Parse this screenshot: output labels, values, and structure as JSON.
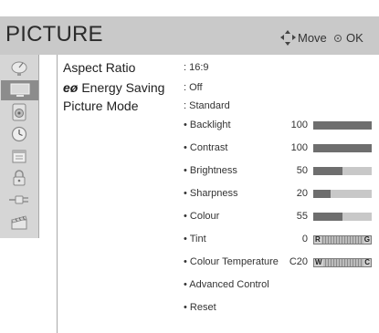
{
  "screen": {
    "title": "PICTURE",
    "hints": {
      "move": "Move",
      "ok": "OK"
    }
  },
  "sidebar": {
    "items": [
      {
        "icon": "satellite-dish-icon",
        "active": false
      },
      {
        "icon": "tv-screen-icon",
        "active": true
      },
      {
        "icon": "speaker-icon",
        "active": false
      },
      {
        "icon": "clock-icon",
        "active": false
      },
      {
        "icon": "calendar-icon",
        "active": false
      },
      {
        "icon": "padlock-icon",
        "active": false
      },
      {
        "icon": "input-plug-icon",
        "active": false
      },
      {
        "icon": "clapperboard-icon",
        "active": false
      }
    ]
  },
  "menu": {
    "aspect_ratio": {
      "label": "Aspect Ratio",
      "value": ": 16:9"
    },
    "energy_saving": {
      "label": "Energy Saving",
      "eco_glyph": "eø",
      "value": ": Off"
    },
    "picture_mode": {
      "label": "Picture Mode",
      "value": ": Standard"
    },
    "settings": [
      {
        "label": "• Backlight",
        "value": "100",
        "level": 1.0,
        "type": "bar"
      },
      {
        "label": "• Contrast",
        "value": "100",
        "level": 1.0,
        "type": "bar"
      },
      {
        "label": "• Brightness",
        "value": "50",
        "level": 0.5,
        "type": "bar"
      },
      {
        "label": "• Sharpness",
        "value": "20",
        "level": 0.3,
        "type": "bar"
      },
      {
        "label": "• Colour",
        "value": "55",
        "level": 0.5,
        "type": "bar"
      },
      {
        "label": "• Tint",
        "value": "0",
        "left": "R",
        "right": "G",
        "level": 0.5,
        "type": "balance"
      },
      {
        "label": "• Colour Temperature",
        "value": "C20",
        "left": "W",
        "right": "C",
        "level": 0.8,
        "type": "balance"
      },
      {
        "label": "• Advanced Control",
        "type": "link"
      },
      {
        "label": "• Reset",
        "type": "link"
      }
    ]
  }
}
